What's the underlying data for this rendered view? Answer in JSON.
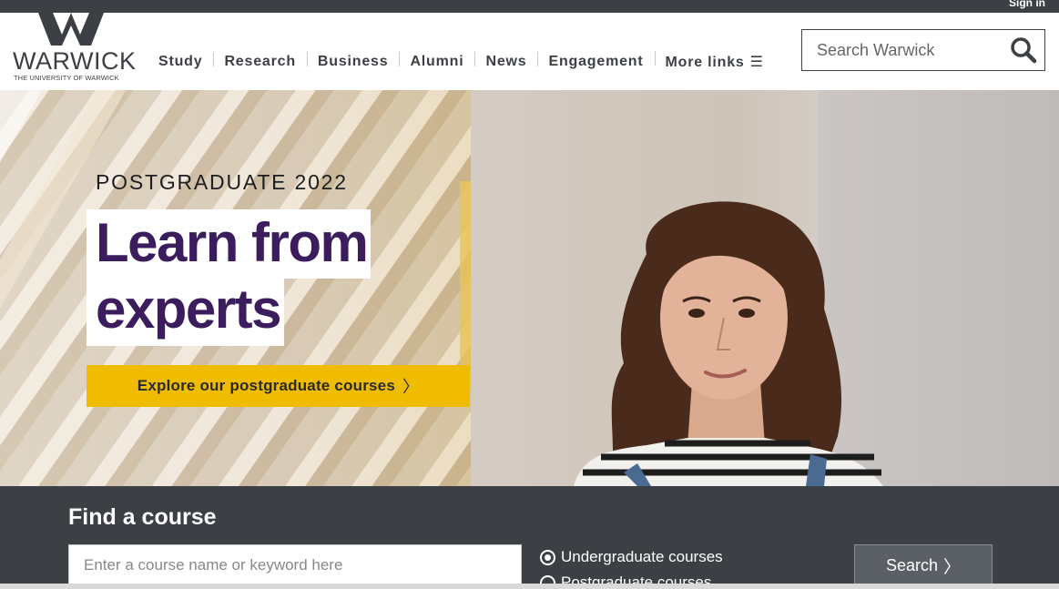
{
  "topbar": {
    "signin": "Sign in"
  },
  "logo": {
    "wordmark": "WARWICK",
    "subtitle": "THE UNIVERSITY OF WARWICK"
  },
  "nav": {
    "items": [
      "Study",
      "Research",
      "Business",
      "Alumni",
      "News",
      "Engagement"
    ],
    "more": "More links",
    "more_icon": "hamburger-icon"
  },
  "search": {
    "placeholder": "Search Warwick",
    "icon": "search-icon"
  },
  "hero": {
    "eyebrow": "POSTGRADUATE 2022",
    "title_line1": "Learn from",
    "title_line2": "experts",
    "cta": "Explore our postgraduate courses",
    "cta_icon": "chevron-right-icon"
  },
  "finder": {
    "title": "Find a course",
    "input_placeholder": "Enter a course name or keyword here",
    "options": [
      {
        "label": "Undergraduate courses",
        "selected": true
      },
      {
        "label": "Postgraduate courses",
        "selected": false
      }
    ],
    "search_label": "Search"
  },
  "colors": {
    "dark_bar": "#3c3f44",
    "brand_purple": "#3b1d5e",
    "cta_yellow": "#f0bc00"
  }
}
